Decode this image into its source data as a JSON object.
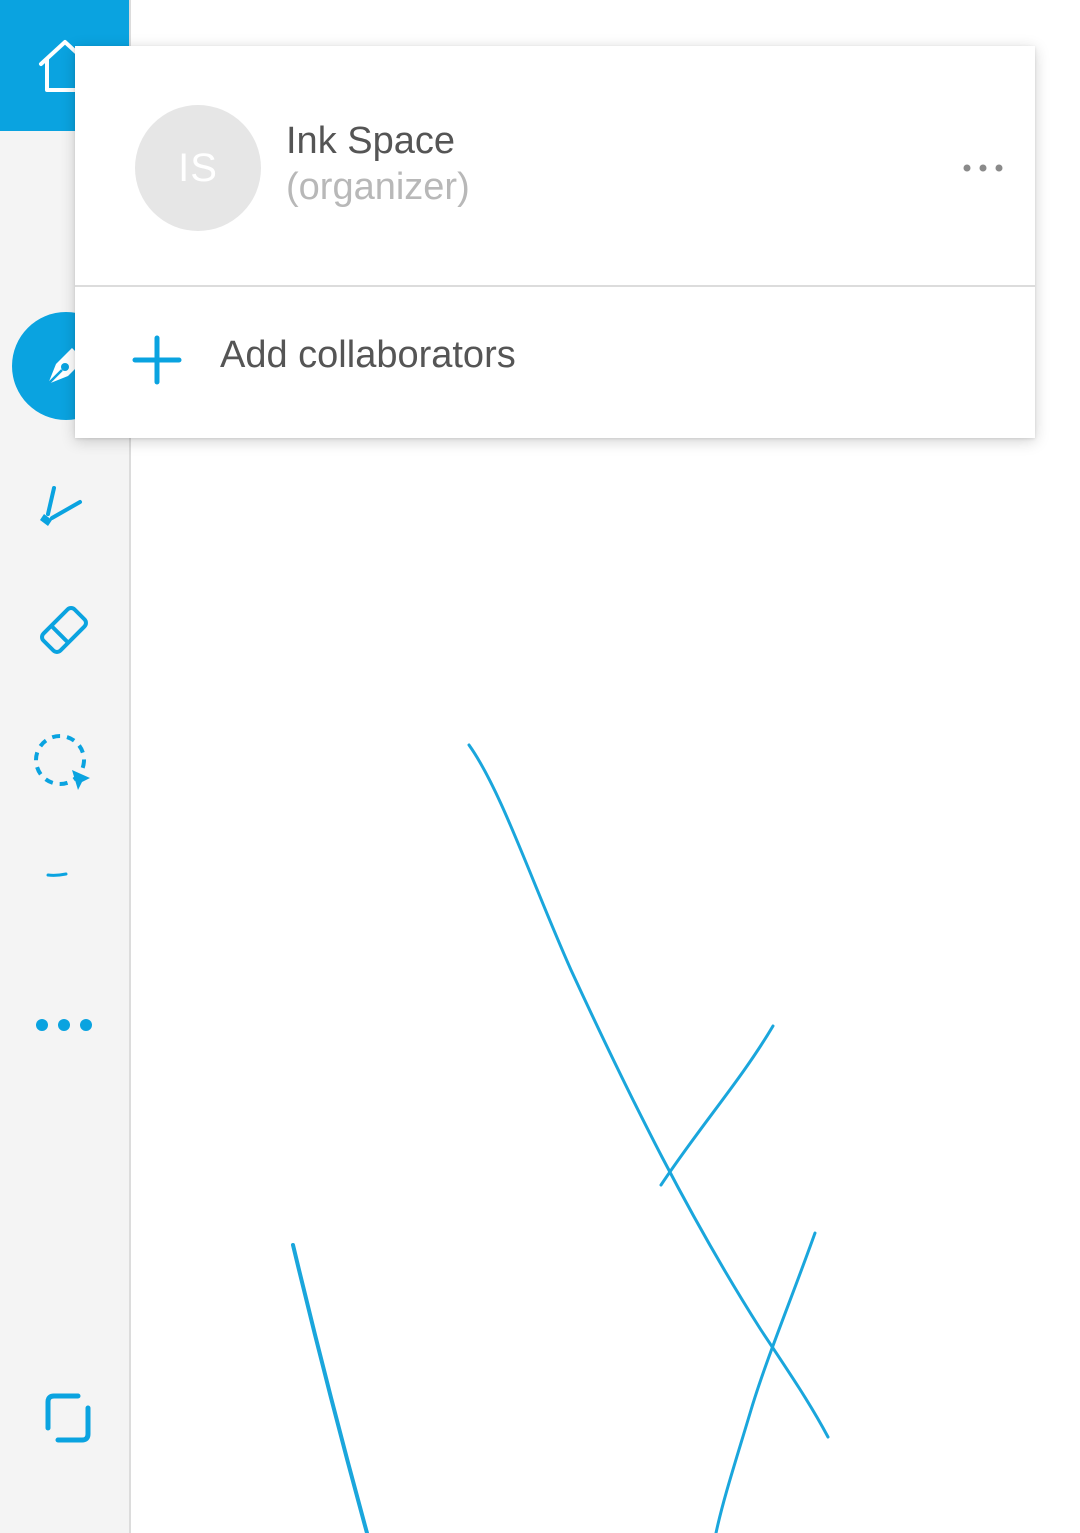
{
  "colors": {
    "accent": "#0aa3e0",
    "sidebar_bg": "#f4f4f4",
    "avatar_bg": "#e6e6e6",
    "text_primary": "#555555",
    "text_secondary": "#b8b8b8",
    "ink": "#1aa6dc"
  },
  "sidebar": {
    "items": [
      {
        "name": "home",
        "icon": "home-icon"
      },
      {
        "name": "pen",
        "icon": "pen-icon",
        "active": true
      },
      {
        "name": "highlighter",
        "icon": "highlighter-icon"
      },
      {
        "name": "eraser",
        "icon": "eraser-icon"
      },
      {
        "name": "lasso-select",
        "icon": "lasso-select-icon"
      },
      {
        "name": "stroke-preview",
        "icon": "stroke-preview-icon"
      },
      {
        "name": "more",
        "icon": "more-dots-icon"
      },
      {
        "name": "fullscreen",
        "icon": "fullscreen-icon"
      }
    ]
  },
  "popup": {
    "collaborator": {
      "initials": "IS",
      "name": "Ink Space",
      "role": "(organizer)",
      "menu_icon": "more-horizontal-icon"
    },
    "add_collaborators": {
      "icon": "plus-icon",
      "label": "Add collaborators"
    }
  }
}
